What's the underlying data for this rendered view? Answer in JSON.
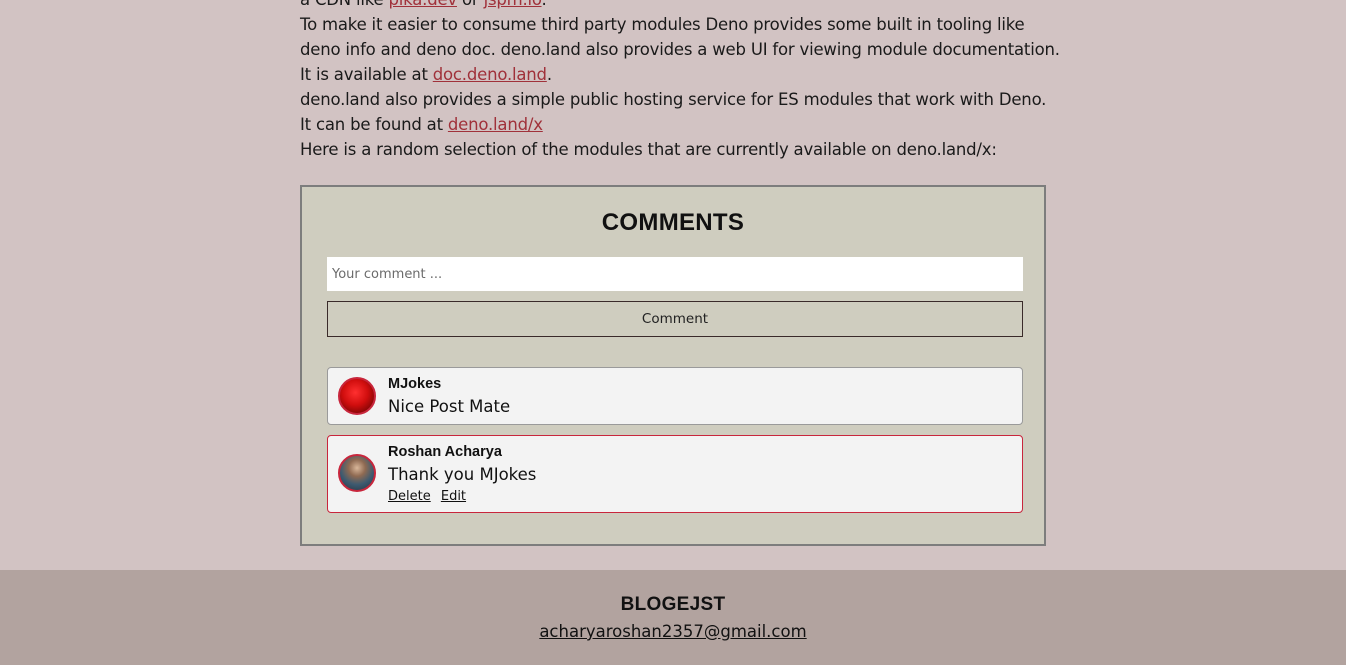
{
  "article": {
    "line1_pre": "a CDN like ",
    "link_pika": "pika.dev",
    "line1_mid": " or ",
    "link_jspm": "jspm.io",
    "line1_post": ".",
    "para2_text": "To make it easier to consume third party modules Deno provides some built in tooling like deno info and deno doc. deno.land also provides a web UI for viewing module documentation. It is available at ",
    "link_doc": "doc.deno.land",
    "para2_post": ".",
    "para3_text": "deno.land also provides a simple public hosting service for ES modules that work with Deno. It can be found at ",
    "link_x": "deno.land/x",
    "para4": "Here is a random selection of the modules that are currently available on deno.land/x:"
  },
  "comments": {
    "title": "COMMENTS",
    "input_placeholder": "Your comment ...",
    "submit_label": "Comment",
    "items": [
      {
        "author": "MJokes",
        "text": "Nice Post Mate",
        "avatar_icon": "user-avatar-icon"
      },
      {
        "author": "Roshan Acharya",
        "text": "Thank you MJokes",
        "avatar_icon": "user-avatar-icon",
        "delete_label": "Delete",
        "edit_label": "Edit"
      }
    ]
  },
  "footer": {
    "brand": "BLOGEJST",
    "email": "acharyaroshan2357@gmail.com"
  },
  "colors": {
    "page_bg": "#d2c3c3",
    "link": "#a0313a",
    "accent_border": "#c8263c",
    "footer_bg": "#b2a39f"
  }
}
